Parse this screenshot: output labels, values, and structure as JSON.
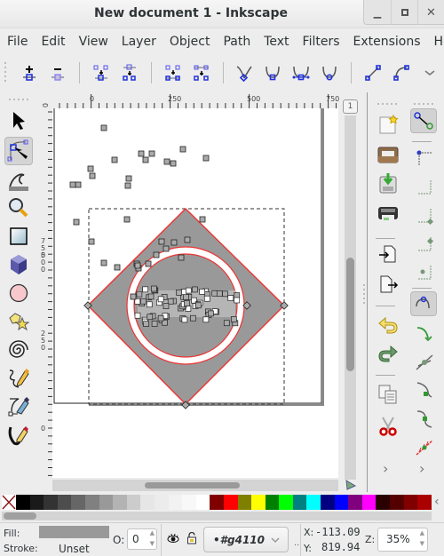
{
  "window": {
    "title": "New document 1 - Inkscape",
    "controls": [
      "minimize",
      "maximize",
      "close"
    ]
  },
  "menubar": {
    "items": [
      "File",
      "Edit",
      "View",
      "Layer",
      "Object",
      "Path",
      "Text",
      "Filters",
      "Extensions",
      "Help"
    ]
  },
  "node_toolbar": {
    "buttons": [
      {
        "name": "insert-node",
        "icon": "plus-node-icon"
      },
      {
        "name": "delete-node",
        "icon": "minus-node-icon"
      },
      {
        "name": "join-nodes",
        "icon": "join-nodes-icon"
      },
      {
        "name": "break-path",
        "icon": "break-path-icon"
      },
      {
        "name": "join-segment",
        "icon": "join-segment-icon"
      },
      {
        "name": "delete-segment",
        "icon": "delete-segment-icon"
      },
      {
        "name": "node-cusp",
        "icon": "node-cusp-icon"
      },
      {
        "name": "node-smooth",
        "icon": "node-smooth-icon"
      },
      {
        "name": "node-symmetric",
        "icon": "node-symmetric-icon"
      },
      {
        "name": "node-auto",
        "icon": "node-auto-icon"
      },
      {
        "name": "segment-line",
        "icon": "segment-line-icon"
      },
      {
        "name": "segment-curve",
        "icon": "segment-curve-icon"
      },
      {
        "name": "more",
        "icon": "chevron-down-icon"
      }
    ]
  },
  "rulers": {
    "top_labels": [
      "0",
      "250",
      "500",
      "750"
    ],
    "left_labels": [
      "0",
      "750",
      "500",
      "250",
      "0"
    ]
  },
  "toolbox": {
    "tools": [
      {
        "name": "selector",
        "icon": "arrow-pointer-icon",
        "active": false
      },
      {
        "name": "node-editor",
        "icon": "node-editor-icon",
        "active": true
      },
      {
        "name": "tweak",
        "icon": "tweak-wave-icon",
        "active": false
      },
      {
        "name": "zoom",
        "icon": "magnifier-icon",
        "active": false
      },
      {
        "name": "rectangle",
        "icon": "rectangle-icon",
        "active": false
      },
      {
        "name": "3d-box",
        "icon": "cube-icon",
        "active": false
      },
      {
        "name": "ellipse",
        "icon": "circle-icon",
        "active": false
      },
      {
        "name": "star",
        "icon": "star-icon",
        "active": false
      },
      {
        "name": "spiral",
        "icon": "spiral-icon",
        "active": false
      },
      {
        "name": "pencil",
        "icon": "pencil-icon",
        "active": false
      },
      {
        "name": "pen",
        "icon": "pen-bezier-icon",
        "active": false
      },
      {
        "name": "calligraphy",
        "icon": "calligraphy-icon",
        "active": false
      }
    ]
  },
  "commands_bar": {
    "buttons": [
      "new-document",
      "open",
      "save",
      "print",
      "import",
      "export",
      "undo",
      "redo",
      "duplicate",
      "cut"
    ],
    "overflow": "›"
  },
  "snap_bar": {
    "buttons": [
      "snap-toggle",
      "snap-bbox",
      "snap-bbox-edge",
      "snap-bbox-corner",
      "snap-bbox-midpoint",
      "snap-bbox-center",
      "snap-nodes",
      "snap-path",
      "snap-intersection",
      "snap-cusp",
      "snap-smooth",
      "snap-midpoint"
    ],
    "overflow": "›"
  },
  "palette": {
    "colors": [
      "none",
      "#000000",
      "#1a1a1a",
      "#333333",
      "#4d4d4d",
      "#666666",
      "#808080",
      "#999999",
      "#b3b3b3",
      "#cccccc",
      "#e6e6e6",
      "#ececec",
      "#f2f2f2",
      "#f8f8f8",
      "#ffffff",
      "#800000",
      "#ff0000",
      "#808000",
      "#ffff00",
      "#008000",
      "#00ff00",
      "#008080",
      "#00ffff",
      "#000080",
      "#0000ff",
      "#800080",
      "#ff00ff",
      "#2b0000",
      "#550000",
      "#800000",
      "#aa0000"
    ]
  },
  "status": {
    "fill_label": "Fill:",
    "stroke_label": "Stroke:",
    "fill_color": "#999999",
    "stroke_value": "Unset",
    "opacity_label": "O:",
    "opacity_value": "0",
    "layer_value": "•#g4110",
    "x_label": "X:",
    "x_value": "-113.09",
    "y_label": "Y:",
    "y_value": "819.94",
    "zoom_label": "Z:",
    "zoom_value": "35%"
  },
  "page_button": "1"
}
